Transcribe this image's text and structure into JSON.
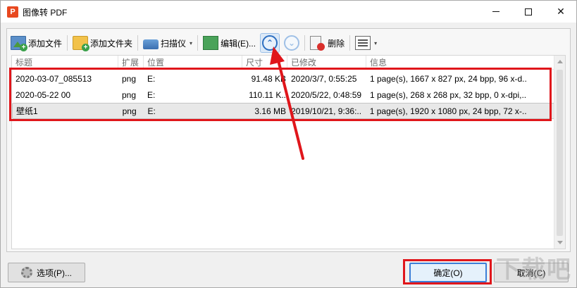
{
  "window": {
    "title": "图像转 PDF",
    "app_icon_letter": "P",
    "controls": {
      "minimize": "",
      "maximize": "",
      "close": "✕"
    }
  },
  "toolbar": {
    "add_file": "添加文件",
    "add_folder": "添加文件夹",
    "scanner": "扫描仪",
    "edit": "编辑(E)...",
    "move_up": "⌃",
    "move_down": "⌄",
    "delete": "删除",
    "view_caret": "▾",
    "scanner_caret": "▾"
  },
  "table": {
    "columns": [
      "标题",
      "扩展",
      "位置",
      "尺寸",
      "已修改",
      "信息"
    ],
    "rows": [
      {
        "title": "2020-03-07_085513",
        "ext": "png",
        "location": "E:",
        "size": "91.48 KB",
        "modified": "2020/3/7, 0:55:25",
        "info": "1 page(s), 1667 x 827 px, 24 bpp, 96 x-d..",
        "selected": false
      },
      {
        "title": "2020-05-22 00",
        "ext": "png",
        "location": "E:",
        "size": "110.11 K..",
        "modified": "2020/5/22, 0:48:59",
        "info": "1 page(s), 268 x 268 px, 32 bpp, 0 x-dpi,..",
        "selected": false
      },
      {
        "title": "壁纸1",
        "ext": "png",
        "location": "E:",
        "size": "3.16 MB",
        "modified": "2019/10/21, 9:36:..",
        "info": "1 page(s), 1920 x 1080 px, 24 bpp, 72 x-..",
        "selected": true
      }
    ]
  },
  "buttons": {
    "options": "选项(P)...",
    "ok": "确定(O)",
    "cancel": "取消(C)"
  },
  "watermark": "下载吧",
  "colors": {
    "annotation_red": "#e0161b",
    "accent_blue": "#2d6fc1"
  }
}
